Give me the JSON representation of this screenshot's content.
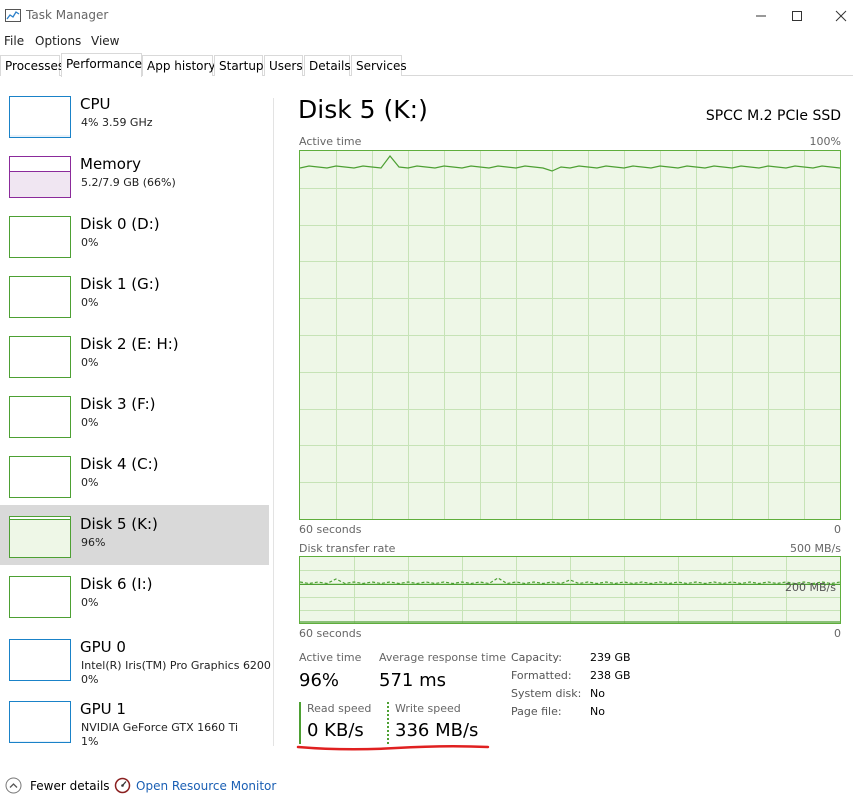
{
  "window": {
    "title": "Task Manager",
    "app_icon": "task-manager-icon",
    "controls": [
      "minimize-icon",
      "maximize-icon",
      "close-icon"
    ]
  },
  "menu": [
    "File",
    "Options",
    "View"
  ],
  "tabs": [
    {
      "label": "Processes",
      "active": false
    },
    {
      "label": "Performance",
      "active": true
    },
    {
      "label": "App history",
      "active": false
    },
    {
      "label": "Startup",
      "active": false
    },
    {
      "label": "Users",
      "active": false
    },
    {
      "label": "Details",
      "active": false
    },
    {
      "label": "Services",
      "active": false
    }
  ],
  "sidebar": [
    {
      "title": "CPU",
      "sub": "4% 3.59 GHz",
      "sub2": "",
      "color": "#1a82c8",
      "level": 0.04
    },
    {
      "title": "Memory",
      "sub": "5.2/7.9 GB (66%)",
      "sub2": "",
      "color": "#8b2a9b",
      "level": 0.66
    },
    {
      "title": "Disk 0 (D:)",
      "sub": "0%",
      "sub2": "",
      "color": "#4da033",
      "level": 0
    },
    {
      "title": "Disk 1 (G:)",
      "sub": "0%",
      "sub2": "",
      "color": "#4da033",
      "level": 0
    },
    {
      "title": "Disk 2 (E: H:)",
      "sub": "0%",
      "sub2": "",
      "color": "#4da033",
      "level": 0
    },
    {
      "title": "Disk 3 (F:)",
      "sub": "0%",
      "sub2": "",
      "color": "#4da033",
      "level": 0
    },
    {
      "title": "Disk 4 (C:)",
      "sub": "0%",
      "sub2": "",
      "color": "#4da033",
      "level": 0
    },
    {
      "title": "Disk 5 (K:)",
      "sub": "96%",
      "sub2": "",
      "color": "#4da033",
      "level": 0.96,
      "selected": true
    },
    {
      "title": "Disk 6 (I:)",
      "sub": "0%",
      "sub2": "",
      "color": "#4da033",
      "level": 0
    },
    {
      "title": "GPU 0",
      "sub": "Intel(R) Iris(TM) Pro Graphics 6200",
      "sub2": "0%",
      "color": "#1a82c8",
      "level": 0
    },
    {
      "title": "GPU 1",
      "sub": "NVIDIA GeForce GTX 1660 Ti",
      "sub2": "1%",
      "color": "#1a82c8",
      "level": 0.01
    }
  ],
  "main": {
    "title": "Disk 5 (K:)",
    "device": "SPCC M.2 PCIe SSD",
    "active_graph": {
      "label": "Active time",
      "max_label": "100%",
      "x_label": "60 seconds",
      "min_label": "0",
      "color": "#4da033",
      "fill": "#eef7e7"
    },
    "transfer_graph": {
      "label": "Disk transfer rate",
      "max_label": "500 MB/s",
      "x_label": "60 seconds",
      "min_label": "0",
      "ref_label": "200 MB/s"
    },
    "stats": {
      "active_time_label": "Active time",
      "active_time_value": "96%",
      "avg_response_label": "Average response time",
      "avg_response_value": "571 ms",
      "read_label": "Read speed",
      "read_value": "0 KB/s",
      "write_label": "Write speed",
      "write_value": "336 MB/s"
    },
    "info": [
      {
        "key": "Capacity:",
        "value": "239 GB"
      },
      {
        "key": "Formatted:",
        "value": "238 GB"
      },
      {
        "key": "System disk:",
        "value": "No"
      },
      {
        "key": "Page file:",
        "value": "No"
      }
    ],
    "annotation_color": "#e02020"
  },
  "footer": {
    "fewer_details": "Fewer details",
    "fewer_icon": "chevron-up-icon",
    "resource_monitor": "Open Resource Monitor",
    "resource_icon": "resource-monitor-icon"
  }
}
